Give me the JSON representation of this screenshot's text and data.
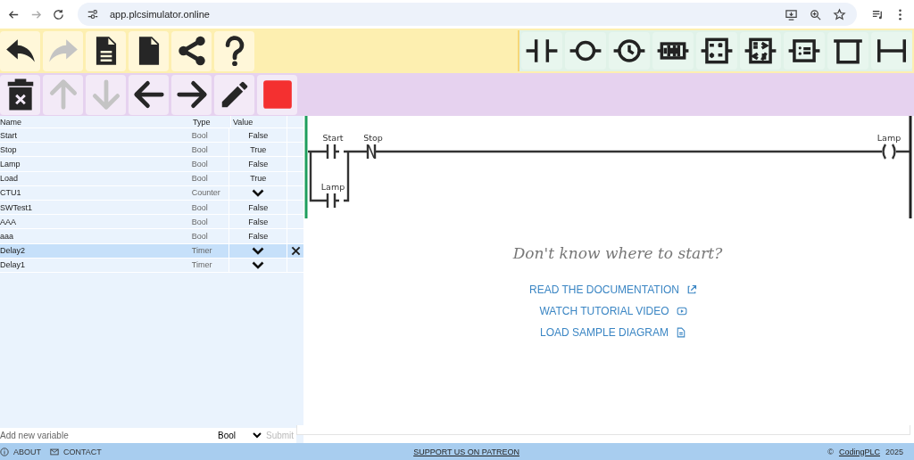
{
  "browser": {
    "url": "app.plcsimulator.online"
  },
  "toolbar_top": [
    {
      "kind": "undo",
      "disabled": false
    },
    {
      "kind": "redo",
      "disabled": true
    },
    {
      "kind": "document",
      "disabled": false
    },
    {
      "kind": "new-file",
      "disabled": false
    },
    {
      "kind": "share",
      "disabled": false
    },
    {
      "kind": "help",
      "disabled": false
    }
  ],
  "toolbar_bottom": [
    {
      "kind": "delete",
      "disabled": false
    },
    {
      "kind": "up",
      "disabled": true
    },
    {
      "kind": "down",
      "disabled": true
    },
    {
      "kind": "left",
      "disabled": false
    },
    {
      "kind": "right",
      "disabled": false
    },
    {
      "kind": "edit",
      "disabled": false
    },
    {
      "kind": "stop",
      "disabled": false
    }
  ],
  "ladder_tools": [
    {
      "kind": "contact"
    },
    {
      "kind": "coil"
    },
    {
      "kind": "timer"
    },
    {
      "kind": "counter"
    },
    {
      "kind": "math"
    },
    {
      "kind": "compare"
    },
    {
      "kind": "assign"
    },
    {
      "kind": "branch-open"
    },
    {
      "kind": "branch"
    }
  ],
  "variables": {
    "columns": [
      "Name",
      "Type",
      "Value"
    ],
    "rows": [
      {
        "name": "Start",
        "type": "Bool",
        "value": "False",
        "expandable": false,
        "selected": false
      },
      {
        "name": "Stop",
        "type": "Bool",
        "value": "True",
        "expandable": false,
        "selected": false
      },
      {
        "name": "Lamp",
        "type": "Bool",
        "value": "False",
        "expandable": false,
        "selected": false
      },
      {
        "name": "Load",
        "type": "Bool",
        "value": "True",
        "expandable": false,
        "selected": false
      },
      {
        "name": "CTU1",
        "type": "Counter",
        "expandable": true,
        "selected": false
      },
      {
        "name": "SWTest1",
        "type": "Bool",
        "value": "False",
        "expandable": false,
        "selected": false
      },
      {
        "name": "AAA",
        "type": "Bool",
        "value": "False",
        "expandable": false,
        "selected": false
      },
      {
        "name": "aaa",
        "type": "Bool",
        "value": "False",
        "expandable": false,
        "selected": false
      },
      {
        "name": "Delay2",
        "type": "Timer",
        "expandable": true,
        "selected": true
      },
      {
        "name": "Delay1",
        "type": "Timer",
        "expandable": true,
        "selected": false
      }
    ],
    "new_variable": {
      "placeholder": "Add new variable",
      "type": "Bool",
      "submit": "Submit"
    }
  },
  "ladder": {
    "contacts": [
      {
        "label": "Start",
        "kind": "no"
      },
      {
        "label": "Stop",
        "kind": "nc"
      },
      {
        "label": "Lamp",
        "kind": "no"
      }
    ],
    "coil": {
      "label": "Lamp"
    }
  },
  "help": {
    "heading": "Don't know where to start?",
    "links": [
      {
        "text": "READ THE DOCUMENTATION",
        "kind": "external"
      },
      {
        "text": "WATCH TUTORIAL VIDEO",
        "kind": "video"
      },
      {
        "text": "LOAD SAMPLE DIAGRAM",
        "kind": "document"
      }
    ]
  },
  "footer": {
    "about": "ABOUT",
    "contact": "CONTACT",
    "support": "SUPPORT US ON PATREON",
    "copyright": "©",
    "company": "CodingPLC",
    "year": "2025"
  }
}
